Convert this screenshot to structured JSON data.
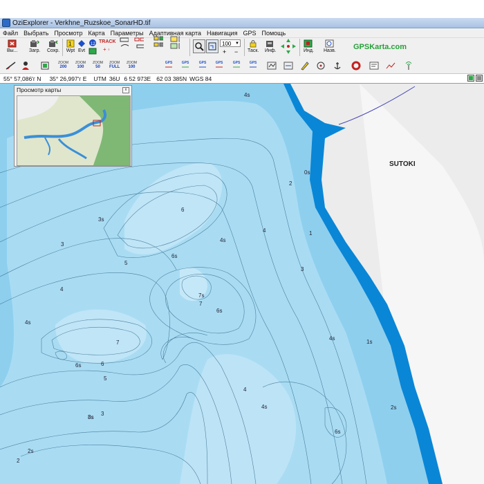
{
  "window": {
    "title": "OziExplorer - Verkhne_Ruzskoe_SonarHD.tif"
  },
  "menu": {
    "items": [
      "Файл",
      "Выбрать",
      "Просмотр",
      "Карта",
      "Параметры",
      "Адаптивная карта",
      "Навигация",
      "GPS",
      "Помощь"
    ]
  },
  "toolbar": {
    "exit_label": "Вы...",
    "load_label": "Загр.",
    "save_label": "Сохр.",
    "wpt_label": "Wpt",
    "evt_label": "Evt",
    "track_label": "TRACK",
    "task_label": "Таск.",
    "info_label": "Инф.",
    "ind_label": "Инд.",
    "names_label": "Назв.",
    "zoom_value": "100",
    "brand": "GPSKarta.com"
  },
  "toolbar2": {
    "zoom_buttons": [
      {
        "top": "ZOOM",
        "value": "200"
      },
      {
        "top": "ZOOM",
        "value": "100"
      },
      {
        "top": "ZOOM",
        "value": "50"
      },
      {
        "top": "ZOOM",
        "value": "FULL"
      },
      {
        "top": "ZOOM",
        "value": "100"
      }
    ],
    "gps_label": "GPS"
  },
  "status": {
    "lat": "55° 57,086'г N",
    "lon": "35° 26,997'г E",
    "utm_label": "UTM",
    "zone": "36U",
    "easting": "6 52 973E",
    "northing": "62 03 385N",
    "datum": "WGS 84"
  },
  "overview": {
    "title": "Просмотр карты",
    "close": "x"
  },
  "map": {
    "place_label": "SUTOKI",
    "depth_labels": [
      "4s",
      "0s",
      "2",
      "1",
      "3s",
      "6",
      "3",
      "4s",
      "4",
      "5",
      "6s",
      "4s",
      "3",
      "7s",
      "7",
      "6s",
      "4",
      "4s",
      "7",
      "6s",
      "6",
      "5",
      "3s",
      "1s",
      "8s",
      "3",
      "4",
      "4s",
      "2s",
      "6s",
      "2s",
      "2"
    ]
  },
  "colors": {
    "deep": "#8ecfee",
    "mid": "#a9dcf3",
    "shallow": "#c5e8f8",
    "shore": "#0a86d6",
    "land": "#ececec",
    "accent": "#27a03a"
  }
}
